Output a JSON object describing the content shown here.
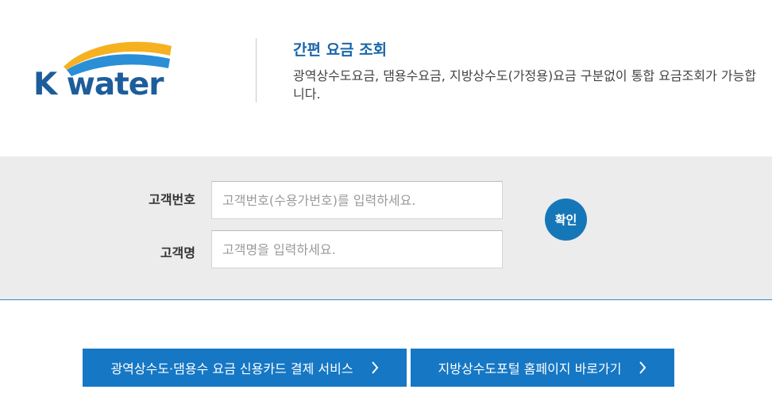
{
  "logo": {
    "text": "K water",
    "colors": {
      "arc_yellow": "#f5b120",
      "arc_blue": "#2a8fd6",
      "text": "#1d5d9b"
    }
  },
  "header": {
    "title": "간편 요금 조회",
    "description": "광역상수도요금, 댐용수요금, 지방상수도(가정용)요금 구분없이 통합 요금조회가 가능합니다."
  },
  "form": {
    "customer_no_label": "고객번호",
    "customer_no_placeholder": "고객번호(수용가번호)를 입력하세요.",
    "customer_no_value": "",
    "customer_name_label": "고객명",
    "customer_name_placeholder": "고객명을 입력하세요.",
    "customer_name_value": "",
    "confirm_label": "확인"
  },
  "links": {
    "card_payment_label": "광역상수도·댐용수 요금 신용카드 결제 서비스",
    "local_portal_label": "지방상수도포털 홈페이지 바로가기",
    "arrow_icon": "chevron-right-icon"
  },
  "colors": {
    "accent": "#1677c4",
    "title": "#1a66a8",
    "form_bg": "#ececec"
  }
}
